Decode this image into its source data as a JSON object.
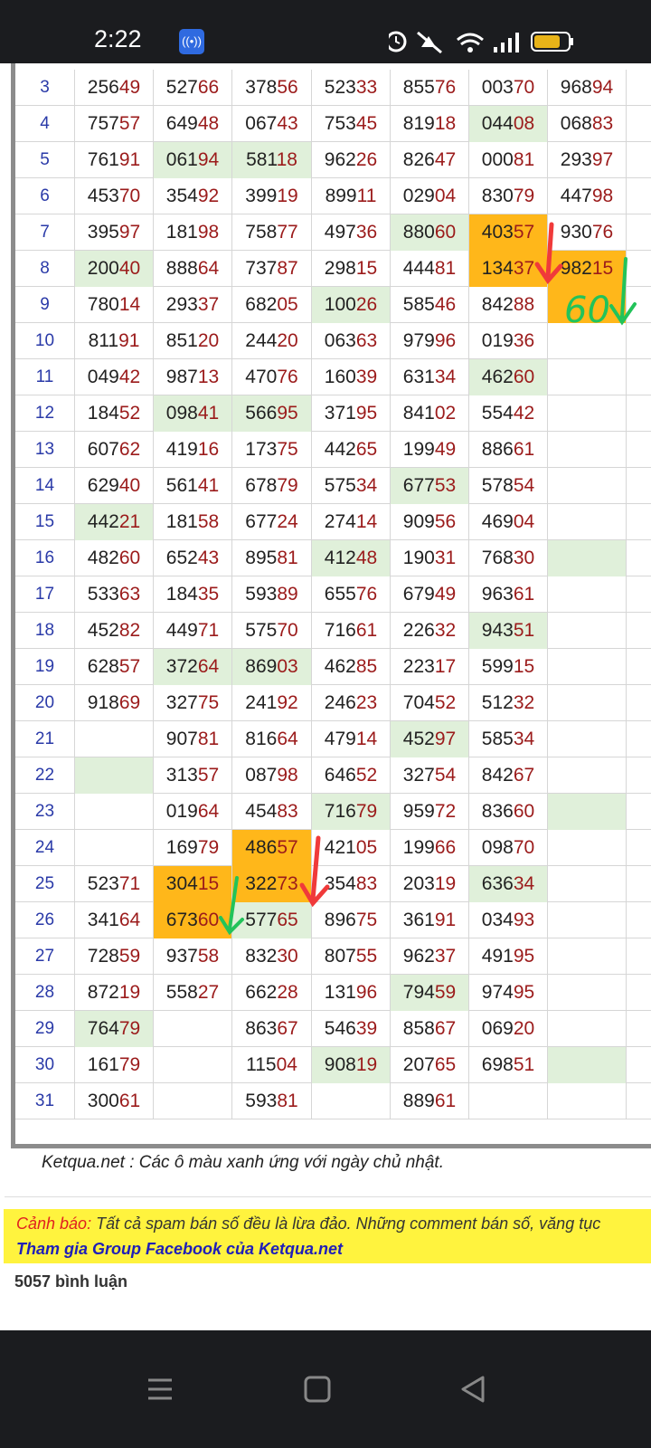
{
  "status_bar": {
    "time": "2:22",
    "icons": [
      "hotspot-icon",
      "alarm-icon",
      "mute-icon",
      "wifi-icon",
      "signal-icon",
      "battery-icon"
    ]
  },
  "table": {
    "rows": [
      {
        "day": "3",
        "cells": [
          {
            "v": "25649",
            "bg": ""
          },
          {
            "v": "52766",
            "bg": ""
          },
          {
            "v": "37856",
            "bg": ""
          },
          {
            "v": "52333",
            "bg": ""
          },
          {
            "v": "85576",
            "bg": ""
          },
          {
            "v": "00370",
            "bg": ""
          },
          {
            "v": "96894",
            "bg": ""
          }
        ]
      },
      {
        "day": "4",
        "cells": [
          {
            "v": "75757",
            "bg": ""
          },
          {
            "v": "64948",
            "bg": ""
          },
          {
            "v": "06743",
            "bg": ""
          },
          {
            "v": "75345",
            "bg": ""
          },
          {
            "v": "81918",
            "bg": ""
          },
          {
            "v": "04408",
            "bg": "green"
          },
          {
            "v": "06883",
            "bg": ""
          }
        ]
      },
      {
        "day": "5",
        "cells": [
          {
            "v": "76191",
            "bg": ""
          },
          {
            "v": "06194",
            "bg": "green"
          },
          {
            "v": "58118",
            "bg": "green"
          },
          {
            "v": "96226",
            "bg": ""
          },
          {
            "v": "82647",
            "bg": ""
          },
          {
            "v": "00081",
            "bg": ""
          },
          {
            "v": "29397",
            "bg": ""
          }
        ]
      },
      {
        "day": "6",
        "cells": [
          {
            "v": "45370",
            "bg": ""
          },
          {
            "v": "35492",
            "bg": ""
          },
          {
            "v": "39919",
            "bg": ""
          },
          {
            "v": "89911",
            "bg": ""
          },
          {
            "v": "02904",
            "bg": ""
          },
          {
            "v": "83079",
            "bg": ""
          },
          {
            "v": "44798",
            "bg": ""
          }
        ]
      },
      {
        "day": "7",
        "cells": [
          {
            "v": "39597",
            "bg": ""
          },
          {
            "v": "18198",
            "bg": ""
          },
          {
            "v": "75877",
            "bg": ""
          },
          {
            "v": "49736",
            "bg": ""
          },
          {
            "v": "88060",
            "bg": "green"
          },
          {
            "v": "40357",
            "bg": "orange"
          },
          {
            "v": "93076",
            "bg": ""
          }
        ]
      },
      {
        "day": "8",
        "cells": [
          {
            "v": "20040",
            "bg": "green"
          },
          {
            "v": "88864",
            "bg": ""
          },
          {
            "v": "73787",
            "bg": ""
          },
          {
            "v": "29815",
            "bg": ""
          },
          {
            "v": "44481",
            "bg": ""
          },
          {
            "v": "13437",
            "bg": "orange"
          },
          {
            "v": "98215",
            "bg": "orange"
          }
        ]
      },
      {
        "day": "9",
        "cells": [
          {
            "v": "78014",
            "bg": ""
          },
          {
            "v": "29337",
            "bg": ""
          },
          {
            "v": "68205",
            "bg": ""
          },
          {
            "v": "10026",
            "bg": "green"
          },
          {
            "v": "58546",
            "bg": ""
          },
          {
            "v": "84288",
            "bg": ""
          },
          {
            "v": "",
            "bg": "orange"
          }
        ]
      },
      {
        "day": "10",
        "cells": [
          {
            "v": "81191",
            "bg": ""
          },
          {
            "v": "85120",
            "bg": ""
          },
          {
            "v": "24420",
            "bg": ""
          },
          {
            "v": "06363",
            "bg": ""
          },
          {
            "v": "97996",
            "bg": ""
          },
          {
            "v": "01936",
            "bg": ""
          },
          {
            "v": "",
            "bg": ""
          }
        ]
      },
      {
        "day": "11",
        "cells": [
          {
            "v": "04942",
            "bg": ""
          },
          {
            "v": "98713",
            "bg": ""
          },
          {
            "v": "47076",
            "bg": ""
          },
          {
            "v": "16039",
            "bg": ""
          },
          {
            "v": "63134",
            "bg": ""
          },
          {
            "v": "46260",
            "bg": "green"
          },
          {
            "v": "",
            "bg": ""
          }
        ]
      },
      {
        "day": "12",
        "cells": [
          {
            "v": "18452",
            "bg": ""
          },
          {
            "v": "09841",
            "bg": "green"
          },
          {
            "v": "56695",
            "bg": "green"
          },
          {
            "v": "37195",
            "bg": ""
          },
          {
            "v": "84102",
            "bg": ""
          },
          {
            "v": "55442",
            "bg": ""
          },
          {
            "v": "",
            "bg": ""
          }
        ]
      },
      {
        "day": "13",
        "cells": [
          {
            "v": "60762",
            "bg": ""
          },
          {
            "v": "41916",
            "bg": ""
          },
          {
            "v": "17375",
            "bg": ""
          },
          {
            "v": "44265",
            "bg": ""
          },
          {
            "v": "19949",
            "bg": ""
          },
          {
            "v": "88661",
            "bg": ""
          },
          {
            "v": "",
            "bg": ""
          }
        ]
      },
      {
        "day": "14",
        "cells": [
          {
            "v": "62940",
            "bg": ""
          },
          {
            "v": "56141",
            "bg": ""
          },
          {
            "v": "67879",
            "bg": ""
          },
          {
            "v": "57534",
            "bg": ""
          },
          {
            "v": "67753",
            "bg": "green"
          },
          {
            "v": "57854",
            "bg": ""
          },
          {
            "v": "",
            "bg": ""
          }
        ]
      },
      {
        "day": "15",
        "cells": [
          {
            "v": "44221",
            "bg": "green"
          },
          {
            "v": "18158",
            "bg": ""
          },
          {
            "v": "67724",
            "bg": ""
          },
          {
            "v": "27414",
            "bg": ""
          },
          {
            "v": "90956",
            "bg": ""
          },
          {
            "v": "46904",
            "bg": ""
          },
          {
            "v": "",
            "bg": ""
          }
        ]
      },
      {
        "day": "16",
        "cells": [
          {
            "v": "48260",
            "bg": ""
          },
          {
            "v": "65243",
            "bg": ""
          },
          {
            "v": "89581",
            "bg": ""
          },
          {
            "v": "41248",
            "bg": "green"
          },
          {
            "v": "19031",
            "bg": ""
          },
          {
            "v": "76830",
            "bg": ""
          },
          {
            "v": "",
            "bg": "green"
          }
        ]
      },
      {
        "day": "17",
        "cells": [
          {
            "v": "53363",
            "bg": ""
          },
          {
            "v": "18435",
            "bg": ""
          },
          {
            "v": "59389",
            "bg": ""
          },
          {
            "v": "65576",
            "bg": ""
          },
          {
            "v": "67949",
            "bg": ""
          },
          {
            "v": "96361",
            "bg": ""
          },
          {
            "v": "",
            "bg": ""
          }
        ]
      },
      {
        "day": "18",
        "cells": [
          {
            "v": "45282",
            "bg": ""
          },
          {
            "v": "44971",
            "bg": ""
          },
          {
            "v": "57570",
            "bg": ""
          },
          {
            "v": "71661",
            "bg": ""
          },
          {
            "v": "22632",
            "bg": ""
          },
          {
            "v": "94351",
            "bg": "green"
          },
          {
            "v": "",
            "bg": ""
          }
        ]
      },
      {
        "day": "19",
        "cells": [
          {
            "v": "62857",
            "bg": ""
          },
          {
            "v": "37264",
            "bg": "green"
          },
          {
            "v": "86903",
            "bg": "green"
          },
          {
            "v": "46285",
            "bg": ""
          },
          {
            "v": "22317",
            "bg": ""
          },
          {
            "v": "59915",
            "bg": ""
          },
          {
            "v": "",
            "bg": ""
          }
        ]
      },
      {
        "day": "20",
        "cells": [
          {
            "v": "91869",
            "bg": ""
          },
          {
            "v": "32775",
            "bg": ""
          },
          {
            "v": "24192",
            "bg": ""
          },
          {
            "v": "24623",
            "bg": ""
          },
          {
            "v": "70452",
            "bg": ""
          },
          {
            "v": "51232",
            "bg": ""
          },
          {
            "v": "",
            "bg": ""
          }
        ]
      },
      {
        "day": "21",
        "cells": [
          {
            "v": "",
            "bg": ""
          },
          {
            "v": "90781",
            "bg": ""
          },
          {
            "v": "81664",
            "bg": ""
          },
          {
            "v": "47914",
            "bg": ""
          },
          {
            "v": "45297",
            "bg": "green"
          },
          {
            "v": "58534",
            "bg": ""
          },
          {
            "v": "",
            "bg": ""
          }
        ]
      },
      {
        "day": "22",
        "cells": [
          {
            "v": "",
            "bg": "green"
          },
          {
            "v": "31357",
            "bg": ""
          },
          {
            "v": "08798",
            "bg": ""
          },
          {
            "v": "64652",
            "bg": ""
          },
          {
            "v": "32754",
            "bg": ""
          },
          {
            "v": "84267",
            "bg": ""
          },
          {
            "v": "",
            "bg": ""
          }
        ]
      },
      {
        "day": "23",
        "cells": [
          {
            "v": "",
            "bg": ""
          },
          {
            "v": "01964",
            "bg": ""
          },
          {
            "v": "45483",
            "bg": ""
          },
          {
            "v": "71679",
            "bg": "green"
          },
          {
            "v": "95972",
            "bg": ""
          },
          {
            "v": "83660",
            "bg": ""
          },
          {
            "v": "",
            "bg": "green"
          }
        ]
      },
      {
        "day": "24",
        "cells": [
          {
            "v": "",
            "bg": ""
          },
          {
            "v": "16979",
            "bg": ""
          },
          {
            "v": "48657",
            "bg": "orange"
          },
          {
            "v": "42105",
            "bg": ""
          },
          {
            "v": "19966",
            "bg": ""
          },
          {
            "v": "09870",
            "bg": ""
          },
          {
            "v": "",
            "bg": ""
          }
        ]
      },
      {
        "day": "25",
        "cells": [
          {
            "v": "52371",
            "bg": ""
          },
          {
            "v": "30415",
            "bg": "orange"
          },
          {
            "v": "32273",
            "bg": "orange"
          },
          {
            "v": "35483",
            "bg": ""
          },
          {
            "v": "20319",
            "bg": ""
          },
          {
            "v": "63634",
            "bg": "green"
          },
          {
            "v": "",
            "bg": ""
          }
        ]
      },
      {
        "day": "26",
        "cells": [
          {
            "v": "34164",
            "bg": ""
          },
          {
            "v": "67360",
            "bg": "orange"
          },
          {
            "v": "57765",
            "bg": "green"
          },
          {
            "v": "89675",
            "bg": ""
          },
          {
            "v": "36191",
            "bg": ""
          },
          {
            "v": "03493",
            "bg": ""
          },
          {
            "v": "",
            "bg": ""
          }
        ]
      },
      {
        "day": "27",
        "cells": [
          {
            "v": "72859",
            "bg": ""
          },
          {
            "v": "93758",
            "bg": ""
          },
          {
            "v": "83230",
            "bg": ""
          },
          {
            "v": "80755",
            "bg": ""
          },
          {
            "v": "96237",
            "bg": ""
          },
          {
            "v": "49195",
            "bg": ""
          },
          {
            "v": "",
            "bg": ""
          }
        ]
      },
      {
        "day": "28",
        "cells": [
          {
            "v": "87219",
            "bg": ""
          },
          {
            "v": "55827",
            "bg": ""
          },
          {
            "v": "66228",
            "bg": ""
          },
          {
            "v": "13196",
            "bg": ""
          },
          {
            "v": "79459",
            "bg": "green"
          },
          {
            "v": "97495",
            "bg": ""
          },
          {
            "v": "",
            "bg": ""
          }
        ]
      },
      {
        "day": "29",
        "cells": [
          {
            "v": "76479",
            "bg": "green"
          },
          {
            "v": "",
            "bg": ""
          },
          {
            "v": "86367",
            "bg": ""
          },
          {
            "v": "54639",
            "bg": ""
          },
          {
            "v": "85867",
            "bg": ""
          },
          {
            "v": "06920",
            "bg": ""
          },
          {
            "v": "",
            "bg": ""
          }
        ]
      },
      {
        "day": "30",
        "cells": [
          {
            "v": "16179",
            "bg": ""
          },
          {
            "v": "",
            "bg": ""
          },
          {
            "v": "11504",
            "bg": ""
          },
          {
            "v": "90819",
            "bg": "green"
          },
          {
            "v": "20765",
            "bg": ""
          },
          {
            "v": "69851",
            "bg": ""
          },
          {
            "v": "",
            "bg": "green"
          }
        ]
      },
      {
        "day": "31",
        "cells": [
          {
            "v": "30061",
            "bg": ""
          },
          {
            "v": "",
            "bg": ""
          },
          {
            "v": "59381",
            "bg": ""
          },
          {
            "v": "",
            "bg": ""
          },
          {
            "v": "88961",
            "bg": ""
          },
          {
            "v": "",
            "bg": ""
          },
          {
            "v": "",
            "bg": ""
          }
        ]
      }
    ]
  },
  "annotations": {
    "handwritten_text": "60"
  },
  "footer": {
    "note": "Ketqua.net : Các ô màu xanh ứng với ngày chủ nhật.",
    "warning_label": "Cảnh báo:",
    "warning_text": " Tất cả spam bán số đều là lừa đảo. Những comment bán số, văng tục",
    "group_link": "Tham gia Group Facebook của Ketqua.net",
    "comment_count": "5057 bình luận"
  },
  "colors": {
    "sunday_green": "#e0f0da",
    "highlight_orange": "#ffb71a",
    "day_blue": "#2a3aa8",
    "digit_red": "#9b1b1b",
    "warning_yellow": "#fff33e"
  },
  "nav_bar": {
    "buttons": [
      "menu-icon",
      "home-icon",
      "back-icon"
    ]
  }
}
